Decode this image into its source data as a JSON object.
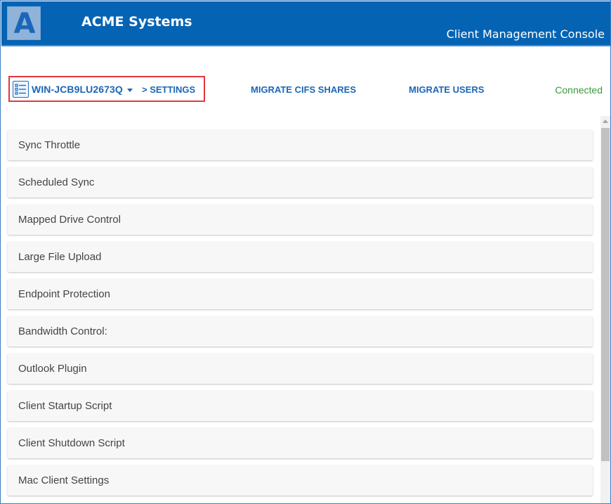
{
  "header": {
    "logo_letter": "A",
    "app_name": "ACME Systems",
    "console_title": "Client Management Console"
  },
  "nav": {
    "server_name": "WIN-JCB9LU2673Q",
    "settings_link": "> SETTINGS",
    "migrate_cifs": "MIGRATE CIFS SHARES",
    "migrate_users": "MIGRATE USERS",
    "status": "Connected"
  },
  "settings": {
    "items": [
      {
        "label": "Sync Throttle"
      },
      {
        "label": "Scheduled Sync"
      },
      {
        "label": "Mapped Drive Control"
      },
      {
        "label": "Large File Upload"
      },
      {
        "label": "Endpoint Protection"
      },
      {
        "label": "Bandwidth Control:"
      },
      {
        "label": "Outlook Plugin"
      },
      {
        "label": "Client Startup Script"
      },
      {
        "label": "Client Shutdown Script"
      },
      {
        "label": "Mac Client Settings"
      }
    ]
  },
  "colors": {
    "header_bg": "#0563b4",
    "link_blue": "#1b66b8",
    "status_green": "#3a9a3a",
    "highlight_red": "#e0383e"
  },
  "icons": {
    "server": "server-list-icon",
    "caret": "caret-down-icon"
  }
}
